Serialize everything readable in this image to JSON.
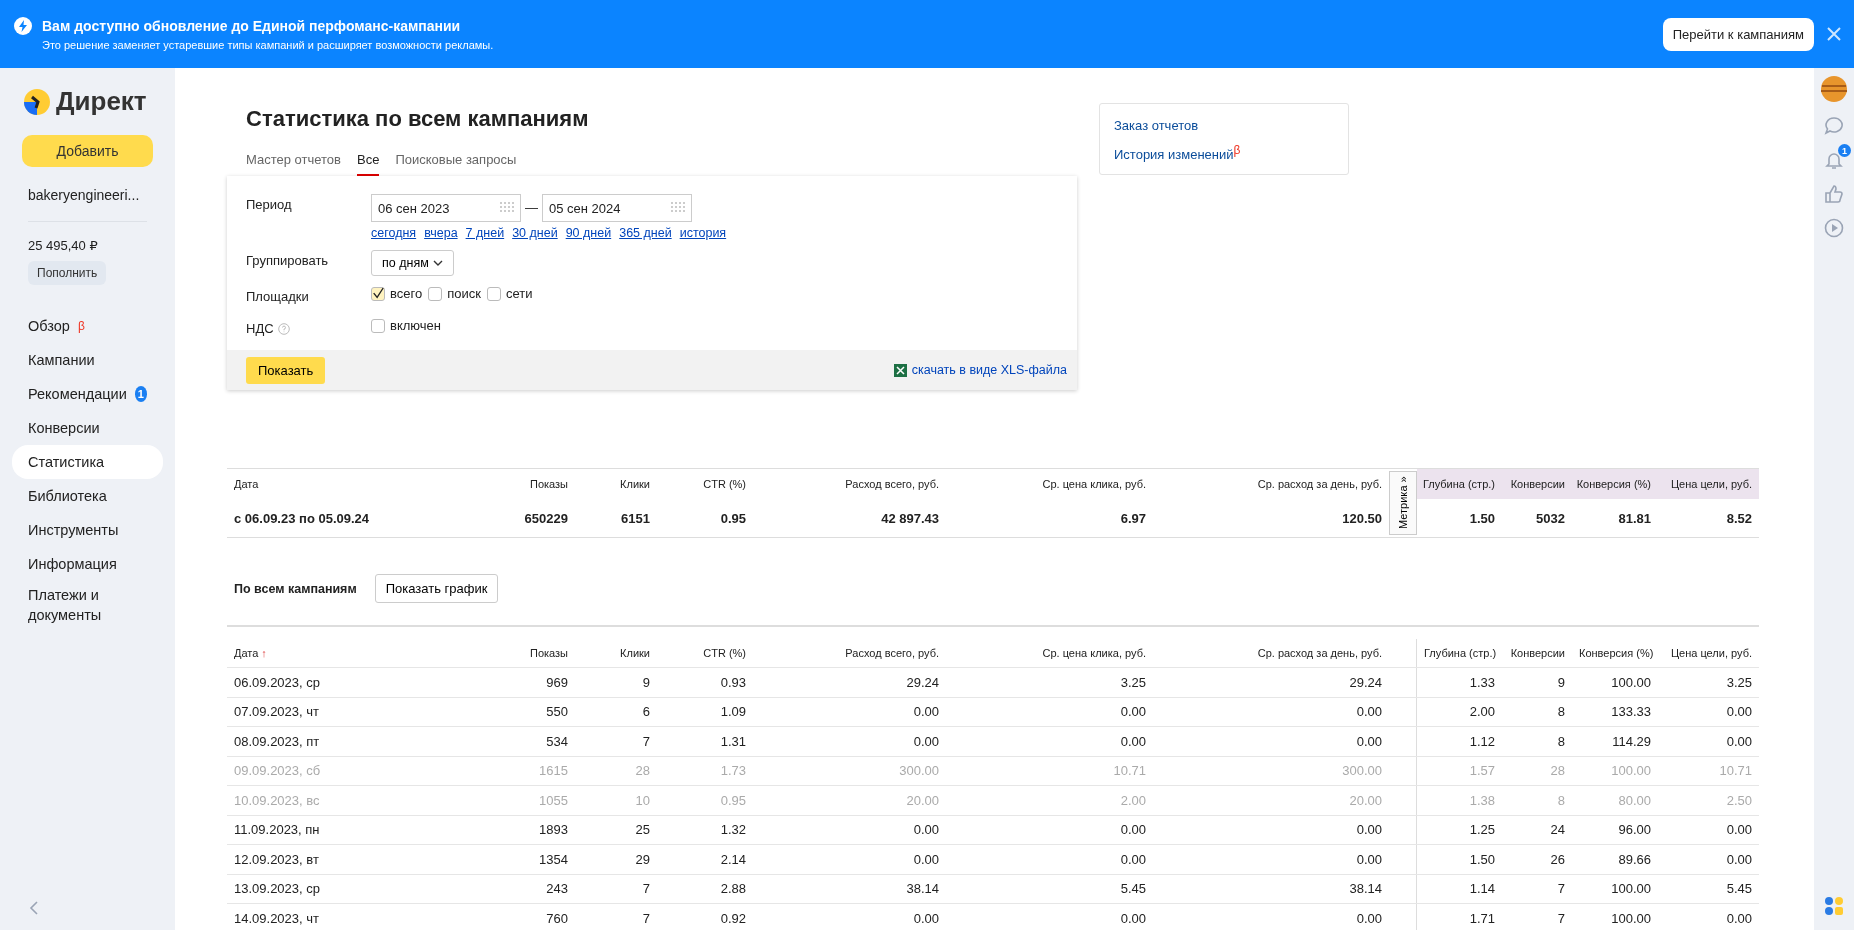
{
  "banner": {
    "title": "Вам доступно обновление до Единой перфоманс-кампании",
    "text": "Это решение заменяет устаревшие типы кампаний и расширяет возможности рекламы.",
    "button": "Перейти к кампаниям"
  },
  "sidebar": {
    "logo": "Директ",
    "add_button": "Добавить",
    "account": "bakeryengineeri...",
    "balance": "25 495,40 ₽",
    "topup_button": "Пополнить",
    "items": [
      {
        "label": "Обзор",
        "selected": false,
        "mark": "β"
      },
      {
        "label": "Кампании",
        "selected": false
      },
      {
        "label": "Рекомендации",
        "selected": false,
        "badge": "1"
      },
      {
        "label": "Конверсии",
        "selected": false
      },
      {
        "label": "Статистика",
        "selected": true
      },
      {
        "label": "Библиотека",
        "selected": false
      },
      {
        "label": "Инструменты",
        "selected": false
      },
      {
        "label": "Информация",
        "selected": false
      },
      {
        "label": "Платежи и документы",
        "selected": false
      }
    ]
  },
  "rail": {
    "notification_badge": "1"
  },
  "page": {
    "title": "Статистика по всем кампаниям",
    "tabs": [
      {
        "label": "Мастер отчетов",
        "selected": false
      },
      {
        "label": "Все",
        "selected": true
      },
      {
        "label": "Поисковые запросы",
        "selected": false
      }
    ]
  },
  "filter": {
    "period_label": "Период",
    "date_from": "06 сен 2023",
    "dash": "—",
    "date_to": "05 сен 2024",
    "quick_ranges": [
      "сегодня",
      "вчера",
      "7 дней",
      "30 дней",
      "90 дней",
      "365 дней",
      "история"
    ],
    "group_label": "Группировать",
    "group_value": "по дням",
    "platforms_label": "Площадки",
    "platforms": [
      {
        "label": "всего",
        "checked": true
      },
      {
        "label": "поиск",
        "checked": false
      },
      {
        "label": "сети",
        "checked": false
      }
    ],
    "vat_label": "НДС",
    "vat_option": {
      "label": "включен",
      "checked": false
    },
    "show_button": "Показать",
    "xls_link": "скачать в виде XLS-файла"
  },
  "side_links": [
    {
      "label": "Заказ отчетов"
    },
    {
      "label": "История изменений",
      "mark": "β"
    }
  ],
  "summary": {
    "columns": [
      "Дата",
      "Показы",
      "Клики",
      "CTR (%)",
      "Расход всего, руб.",
      "Ср. цена клика, руб.",
      "Ср. расход за день, руб.",
      "Глубина (стр.)",
      "Конверсии",
      "Конверсия (%)",
      "Цена цели, руб."
    ],
    "metrika_tab": "Метрика »",
    "values": [
      "с 06.09.23 по 05.09.24",
      "650229",
      "6151",
      "0.95",
      "42 897.43",
      "6.97",
      "120.50",
      "1.50",
      "5032",
      "81.81",
      "8.52"
    ]
  },
  "section": {
    "title": "По всем кампаниям",
    "button": "Показать график"
  },
  "table": {
    "sort_mark": "↑",
    "columns": [
      "Дата",
      "Показы",
      "Клики",
      "CTR (%)",
      "Расход всего, руб.",
      "Ср. цена клика, руб.",
      "Ср. расход за день, руб.",
      "Глубина (стр.)",
      "Конверсии",
      "Конверсия (%)",
      "Цена цели, руб."
    ],
    "rows": [
      {
        "muted": false,
        "cells": [
          "06.09.2023, ср",
          "969",
          "9",
          "0.93",
          "29.24",
          "3.25",
          "29.24",
          "1.33",
          "9",
          "100.00",
          "3.25"
        ]
      },
      {
        "muted": false,
        "cells": [
          "07.09.2023, чт",
          "550",
          "6",
          "1.09",
          "0.00",
          "0.00",
          "0.00",
          "2.00",
          "8",
          "133.33",
          "0.00"
        ]
      },
      {
        "muted": false,
        "cells": [
          "08.09.2023, пт",
          "534",
          "7",
          "1.31",
          "0.00",
          "0.00",
          "0.00",
          "1.12",
          "8",
          "114.29",
          "0.00"
        ]
      },
      {
        "muted": true,
        "cells": [
          "09.09.2023, сб",
          "1615",
          "28",
          "1.73",
          "300.00",
          "10.71",
          "300.00",
          "1.57",
          "28",
          "100.00",
          "10.71"
        ]
      },
      {
        "muted": true,
        "cells": [
          "10.09.2023, вс",
          "1055",
          "10",
          "0.95",
          "20.00",
          "2.00",
          "20.00",
          "1.38",
          "8",
          "80.00",
          "2.50"
        ]
      },
      {
        "muted": false,
        "cells": [
          "11.09.2023, пн",
          "1893",
          "25",
          "1.32",
          "0.00",
          "0.00",
          "0.00",
          "1.25",
          "24",
          "96.00",
          "0.00"
        ]
      },
      {
        "muted": false,
        "cells": [
          "12.09.2023, вт",
          "1354",
          "29",
          "2.14",
          "0.00",
          "0.00",
          "0.00",
          "1.50",
          "26",
          "89.66",
          "0.00"
        ]
      },
      {
        "muted": false,
        "cells": [
          "13.09.2023, ср",
          "243",
          "7",
          "2.88",
          "38.14",
          "5.45",
          "38.14",
          "1.14",
          "7",
          "100.00",
          "5.45"
        ]
      },
      {
        "muted": false,
        "cells": [
          "14.09.2023, чт",
          "760",
          "7",
          "0.92",
          "0.00",
          "0.00",
          "0.00",
          "1.71",
          "7",
          "100.00",
          "0.00"
        ]
      }
    ]
  }
}
